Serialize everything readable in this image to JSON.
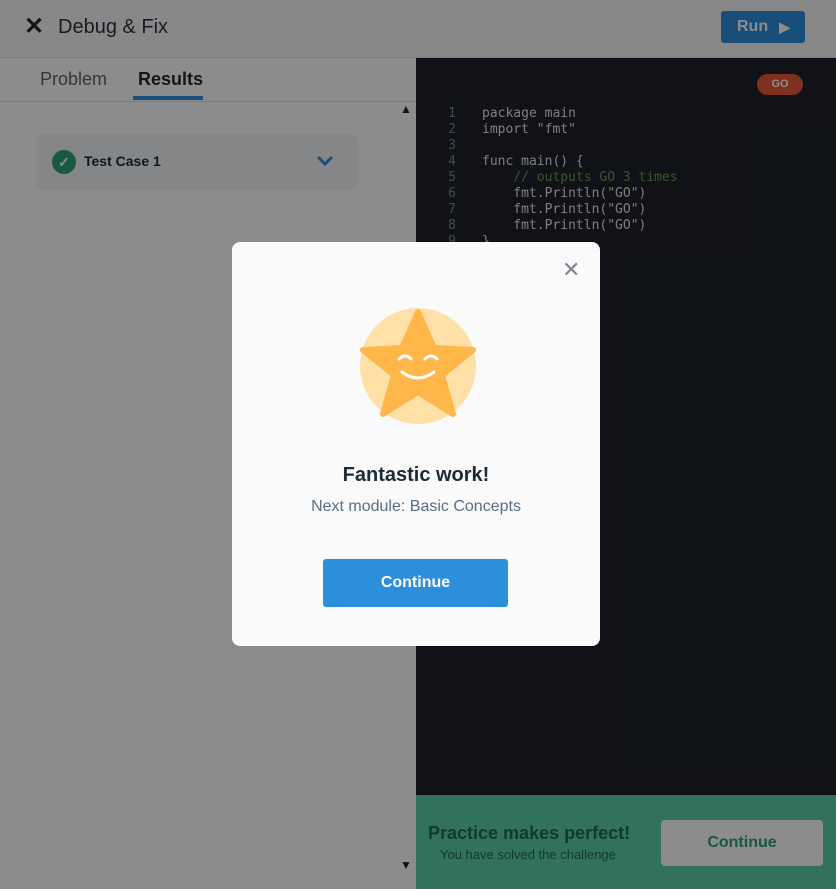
{
  "header": {
    "title": "Debug & Fix",
    "close_icon": "close-icon",
    "run_label": "Run",
    "run_icon": "play-icon"
  },
  "tabs": [
    {
      "label": "Problem",
      "active": false
    },
    {
      "label": "Results",
      "active": true
    }
  ],
  "results": {
    "test_cases": [
      {
        "label": "Test Case 1",
        "status": "passed",
        "status_icon": "check-circle-icon",
        "toggle_icon": "chevron-down-icon"
      }
    ]
  },
  "editor": {
    "language_badge": "GO",
    "lines": [
      {
        "num": "1",
        "text": "package main"
      },
      {
        "num": "2",
        "text": "import \"fmt\""
      },
      {
        "num": "3",
        "text": ""
      },
      {
        "num": "4",
        "text": "func main() {"
      },
      {
        "num": "5",
        "text": "    // outputs GO 3 times"
      },
      {
        "num": "6",
        "text": "    fmt.Println(\"GO\")"
      },
      {
        "num": "7",
        "text": "    fmt.Println(\"GO\")"
      },
      {
        "num": "8",
        "text": "    fmt.Println(\"GO\")"
      },
      {
        "num": "9",
        "text": "}"
      }
    ]
  },
  "footer_bar": {
    "title": "Practice makes perfect!",
    "subtitle": "You have solved the challenge",
    "continue_label": "Continue"
  },
  "modal": {
    "close_icon": "close-icon",
    "illustration": "smiling-star-icon",
    "title": "Fantastic work!",
    "subtitle": "Next module: Basic Concepts",
    "continue_label": "Continue"
  },
  "colors": {
    "accent": "#2c8fdc",
    "success": "#2fa27a",
    "footer_green": "#5bd0a9",
    "language_badge": "#e85a39",
    "editor_bg": "#1e222a",
    "star": "#ffb74a"
  }
}
